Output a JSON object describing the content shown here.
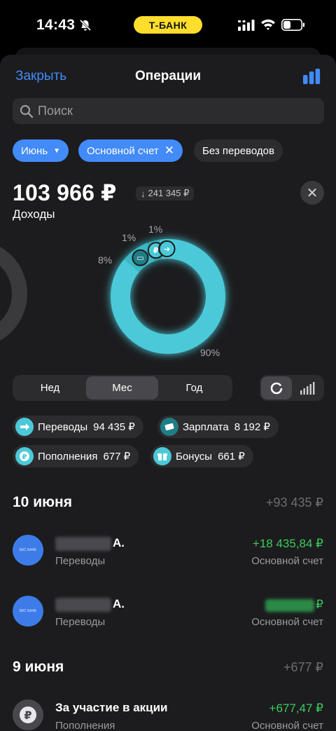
{
  "status": {
    "time": "14:43",
    "bank": "Т-БАНК"
  },
  "header": {
    "close_label": "Закрыть",
    "title": "Операции"
  },
  "search": {
    "placeholder": "Поиск"
  },
  "filters": {
    "month": "Июнь",
    "account": "Основной счет",
    "no_transfers": "Без переводов"
  },
  "summary": {
    "amount": "103 966 ₽",
    "delta": "241 345 ₽",
    "label": "Доходы"
  },
  "chart_data": {
    "type": "pie",
    "categories": [
      "Переводы",
      "Зарплата",
      "Пополнения",
      "Бонусы"
    ],
    "values": [
      90,
      8,
      1,
      1
    ],
    "value_labels": [
      "90%",
      "8%",
      "1%",
      "1%"
    ]
  },
  "period": {
    "day": "Нед",
    "month": "Мес",
    "year": "Год"
  },
  "categories": [
    {
      "label": "Переводы",
      "value": "94 435 ₽"
    },
    {
      "label": "Зарплата",
      "value": "8 192 ₽"
    },
    {
      "label": "Пополнения",
      "value": "677 ₽"
    },
    {
      "label": "Бонусы",
      "value": "661 ₽"
    }
  ],
  "days": [
    {
      "date": "10 июня",
      "total": "+93 435 ₽",
      "items": [
        {
          "name_suffix": "А.",
          "category": "Переводы",
          "amount": "+18 435,84 ₽",
          "account": "Основной счет",
          "logo": "БКС БАНК"
        },
        {
          "name_suffix": "А.",
          "category": "Переводы",
          "amount": "₽",
          "account": "Основной счет",
          "logo": "БКС БАНК"
        }
      ]
    },
    {
      "date": "9 июня",
      "total": "+677 ₽",
      "items": [
        {
          "name": "За участие в акции",
          "category": "Пополнения",
          "amount": "+677,47 ₽",
          "account": "Основной счет"
        }
      ]
    }
  ],
  "colors": {
    "accent": "#428bf9",
    "teal": "#4bc9d8",
    "positive": "#3ccb5d",
    "bank_yellow": "#ffdd2d"
  }
}
